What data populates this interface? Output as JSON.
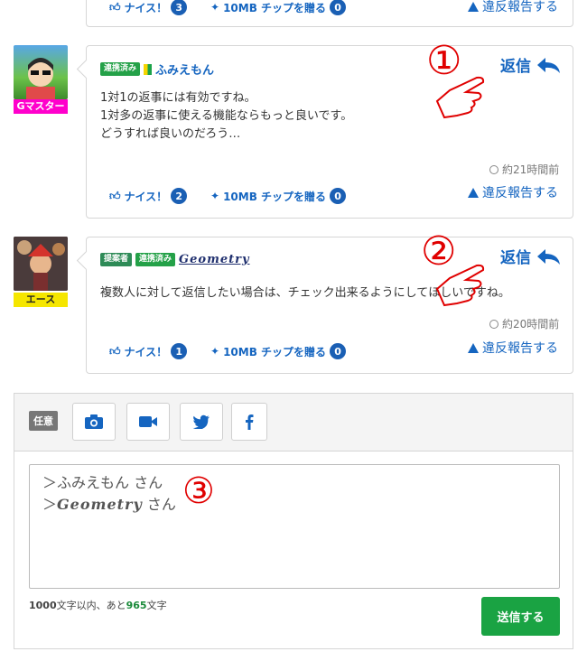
{
  "top_card": {
    "nice_label": "ナイス！",
    "nice_count": "3",
    "chip_label": "10MB チップを贈る",
    "chip_count": "0",
    "report_label": "違反報告する"
  },
  "comments": [
    {
      "rank": "Gマスター",
      "badges": [
        "連携済み"
      ],
      "username": "ふみえもん",
      "reply_label": "返信",
      "message": "1対1の返事には有効ですね。\n1対多の返事に使える機能ならもっと良いです。\nどうすれば良いのだろう…",
      "time": "約21時間前",
      "nice_label": "ナイス！",
      "nice_count": "2",
      "chip_label": "10MB チップを贈る",
      "chip_count": "0",
      "report_label": "違反報告する",
      "annotation": "①"
    },
    {
      "rank": "エース",
      "badges": [
        "提案者",
        "連携済み"
      ],
      "username": "Geometry",
      "reply_label": "返信",
      "message": "複数人に対して返信したい場合は、チェック出来るようにしてほしいですね。",
      "time": "約20時間前",
      "nice_label": "ナイス！",
      "nice_count": "1",
      "chip_label": "10MB チップを贈る",
      "chip_count": "0",
      "report_label": "違反報告する",
      "annotation": "②"
    }
  ],
  "compose": {
    "optional_label": "任意",
    "lines": [
      "＞ふみえもん さん",
      "＞Geometry さん"
    ],
    "annotation": "③",
    "limit": "1000",
    "limit_text_1": "文字以内、あと",
    "remaining": "965",
    "limit_text_2": "文字",
    "send_label": "送信する"
  },
  "colors": {
    "accent": "#1565c0",
    "send": "#1aa343",
    "annotation": "#e00000",
    "rank_gmaster": "#ff00cc",
    "rank_ace": "#f5e600"
  },
  "icons": [
    "thumbs-up-icon",
    "gift-icon",
    "warning-icon",
    "clock-icon",
    "reply-arrow-icon",
    "camera-icon",
    "video-icon",
    "twitter-icon",
    "facebook-icon",
    "pointing-hand-icon"
  ]
}
